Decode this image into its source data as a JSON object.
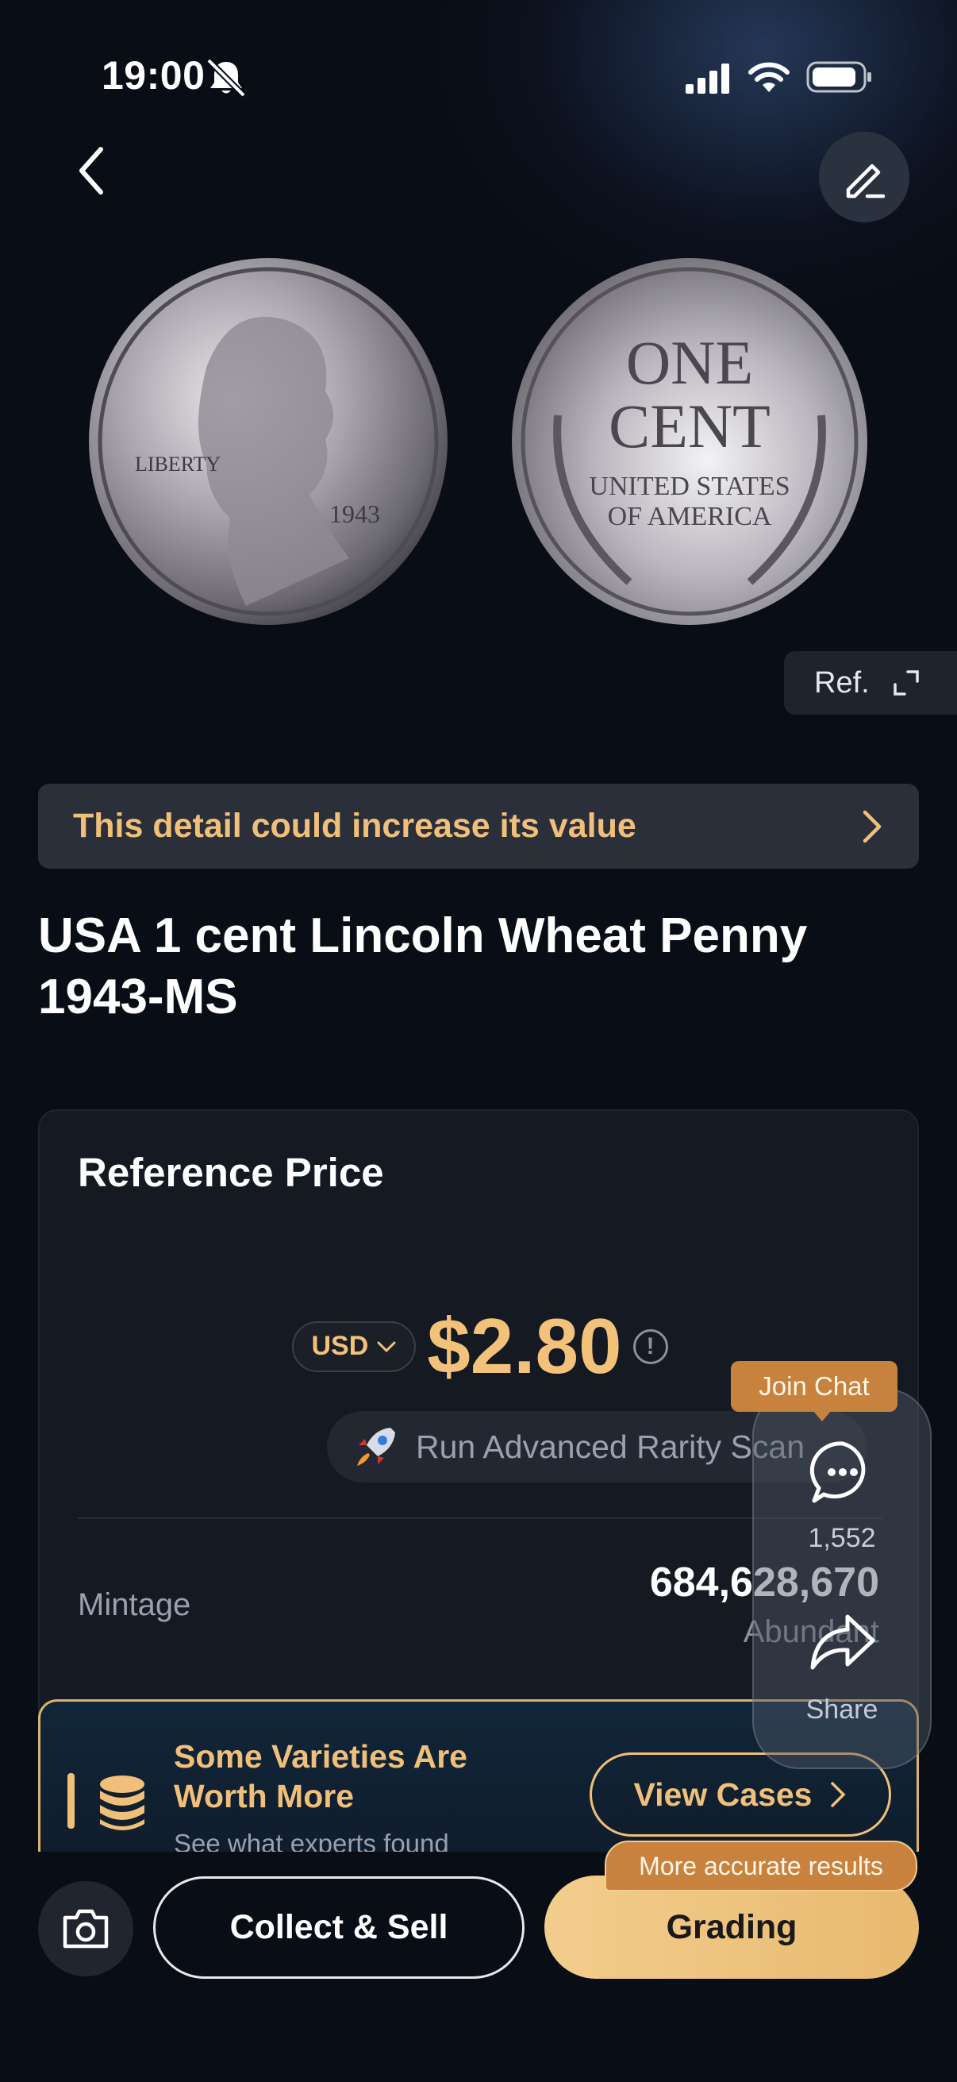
{
  "status_bar": {
    "time": "19:00"
  },
  "header": {
    "back_icon": "chevron-left-icon",
    "edit_icon": "edit-icon"
  },
  "coins": {
    "obverse_icon": "coin-obverse-image",
    "reverse_icon": "coin-reverse-image"
  },
  "ref_button": {
    "label": "Ref."
  },
  "detail_banner": {
    "text": "This detail could increase its value"
  },
  "coin_title": "USA 1 cent  Lincoln Wheat Penny\n1943-MS",
  "reference_price": {
    "title": "Reference Price",
    "currency": "USD",
    "price": "$2.80",
    "scan_label": "Run Advanced Rarity Scan",
    "scan_icon": "rocket-icon"
  },
  "mintage": {
    "label": "Mintage",
    "value": "684,628,670",
    "rarity": "Abundant"
  },
  "varieties": {
    "title": "Some Varieties Are\nWorth More",
    "subtitle": "See what experts found",
    "button_label": "View Cases"
  },
  "floating": {
    "join_chat": "Join Chat",
    "chat_count": "1,552",
    "share": "Share"
  },
  "bottom": {
    "collect_label": "Collect & Sell",
    "grading_label": "Grading",
    "accurate_badge": "More accurate results"
  },
  "colors": {
    "accent_gold": "#f0c07a",
    "background": "#090d16",
    "badge_orange": "#c9823e"
  }
}
